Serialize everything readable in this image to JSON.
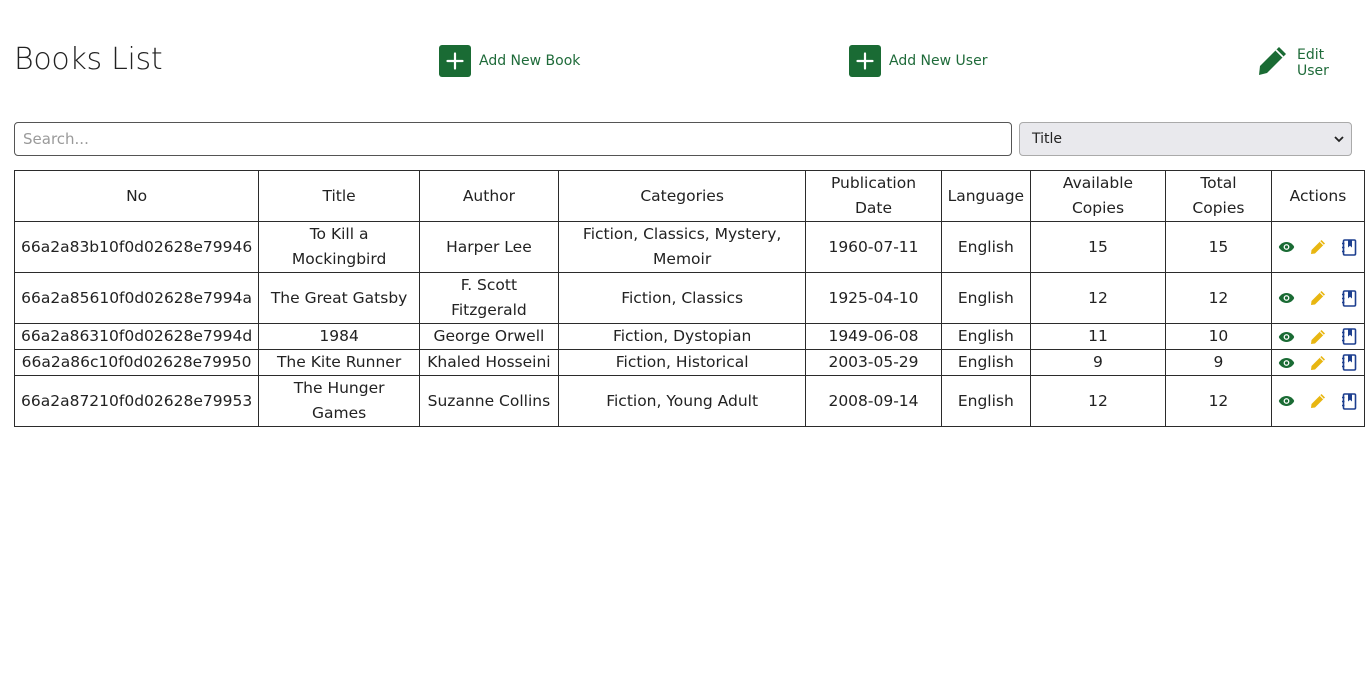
{
  "header": {
    "title": "Books List",
    "add_book_label": "Add New Book",
    "add_user_label": "Add New User",
    "edit_user_label": "Edit User"
  },
  "search": {
    "placeholder": "Search...",
    "value": ""
  },
  "filter": {
    "selected": "Title"
  },
  "colors": {
    "brand_green": "#1a6b34",
    "edit_yellow": "#e8b611",
    "view_green": "#1a6b34",
    "issue_blue": "#1d3f8f"
  },
  "table": {
    "columns": [
      "No",
      "Title",
      "Author",
      "Categories",
      "Publication Date",
      "Language",
      "Available Copies",
      "Total Copies",
      "Actions"
    ],
    "rows": [
      {
        "id": "66a2a83b10f0d02628e79946",
        "title": "To Kill a Mockingbird",
        "author": "Harper Lee",
        "categories": "Fiction, Classics, Mystery, Memoir",
        "date": "1960-07-11",
        "language": "English",
        "available": "15",
        "total": "15"
      },
      {
        "id": "66a2a85610f0d02628e7994a",
        "title": "The Great Gatsby",
        "author": "F. Scott Fitzgerald",
        "categories": "Fiction, Classics",
        "date": "1925-04-10",
        "language": "English",
        "available": "12",
        "total": "12"
      },
      {
        "id": "66a2a86310f0d02628e7994d",
        "title": "1984",
        "author": "George Orwell",
        "categories": "Fiction, Dystopian",
        "date": "1949-06-08",
        "language": "English",
        "available": "11",
        "total": "10"
      },
      {
        "id": "66a2a86c10f0d02628e79950",
        "title": "The Kite Runner",
        "author": "Khaled Hosseini",
        "categories": "Fiction, Historical",
        "date": "2003-05-29",
        "language": "English",
        "available": "9",
        "total": "9"
      },
      {
        "id": "66a2a87210f0d02628e79953",
        "title": "The Hunger Games",
        "author": "Suzanne Collins",
        "categories": "Fiction, Young Adult",
        "date": "2008-09-14",
        "language": "English",
        "available": "12",
        "total": "12"
      }
    ],
    "row_actions": [
      "eye-icon",
      "pencil-icon",
      "book-issue-icon"
    ]
  }
}
